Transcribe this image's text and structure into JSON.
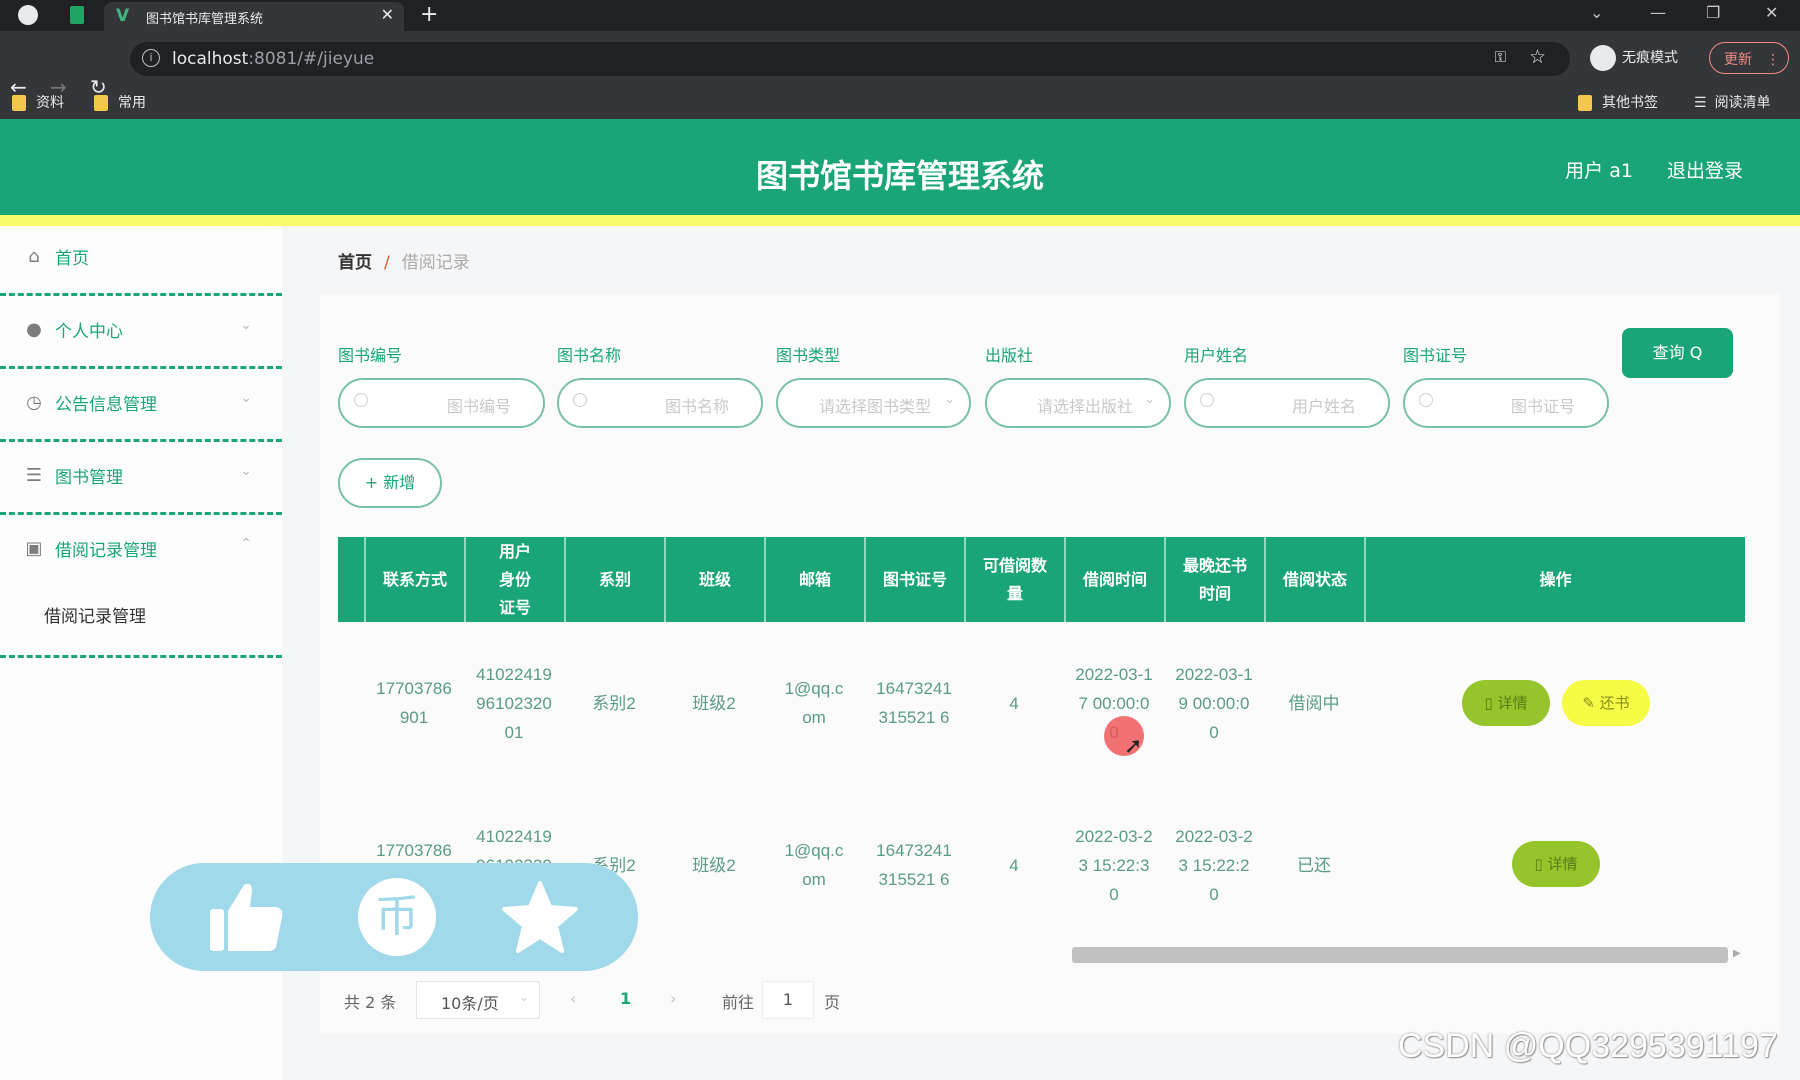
{
  "browser": {
    "tab_title": "图书馆书库管理系统",
    "url_host": "localhost",
    "url_path": ":8081/#/jieyue",
    "incognito_label": "无痕模式",
    "update_label": "更新",
    "bookmarks_left": [
      "资料",
      "常用"
    ],
    "bookmarks_right": [
      "其他书签",
      "阅读清单"
    ]
  },
  "header": {
    "title": "图书馆书库管理系统",
    "user_label": "用户 a1",
    "logout_label": "退出登录"
  },
  "sidebar": {
    "items": [
      {
        "label": "首页",
        "icon": "home-icon"
      },
      {
        "label": "个人中心",
        "icon": "user-icon"
      },
      {
        "label": "公告信息管理",
        "icon": "clock-icon"
      },
      {
        "label": "图书管理",
        "icon": "list-icon"
      },
      {
        "label": "借阅记录管理",
        "icon": "clipboard-icon"
      }
    ],
    "sub_items": [
      "借阅记录管理"
    ]
  },
  "breadcrumb": {
    "home": "首页",
    "separator": "/",
    "current": "借阅记录"
  },
  "filters": [
    {
      "label": "图书编号",
      "placeholder": "图书编号",
      "type": "input"
    },
    {
      "label": "图书名称",
      "placeholder": "图书名称",
      "type": "input"
    },
    {
      "label": "图书类型",
      "placeholder": "请选择图书类型",
      "type": "select"
    },
    {
      "label": "出版社",
      "placeholder": "请选择出版社",
      "type": "select"
    },
    {
      "label": "用户姓名",
      "placeholder": "用户姓名",
      "type": "input"
    },
    {
      "label": "图书证号",
      "placeholder": "图书证号",
      "type": "input"
    }
  ],
  "buttons": {
    "query": "查询 Q",
    "add": "+ 新增",
    "detail": "详情",
    "return": "还书"
  },
  "table": {
    "columns": [
      "联系方式",
      "用户身份证号",
      "系别",
      "班级",
      "邮箱",
      "图书证号",
      "可借阅数量",
      "借阅时间",
      "最晚还书时间",
      "借阅状态",
      "操作"
    ],
    "rows": [
      {
        "phone": "17703786901",
        "id_card": "410224199610232001",
        "department": "系别2",
        "class": "班级2",
        "email": "1@qq.com",
        "card_no": "16473241315521 6",
        "quantity": "4",
        "borrow_time": "2022-03-17 00:00:00",
        "due_time": "2022-03-19 00:00:00",
        "status": "借阅中",
        "actions": [
          "详情",
          "还书"
        ]
      },
      {
        "phone": "17703786901",
        "id_card": "410224199610232001",
        "department": "系别2",
        "class": "班级2",
        "email": "1@qq.com",
        "card_no": "16473241315521 6",
        "quantity": "4",
        "borrow_time": "2022-03-23 15:22:30",
        "due_time": "2022-03-23 15:22:20",
        "status": "已还",
        "actions": [
          "详情"
        ]
      }
    ]
  },
  "pagination": {
    "total": "共 2 条",
    "page_size": "10条/页",
    "current_page": "1",
    "goto_label": "前往",
    "goto_value": "1",
    "page_suffix": "页"
  },
  "overlay": {
    "icons": [
      "thumbs-up-icon",
      "coin-icon",
      "star-icon"
    ]
  },
  "watermark": "CSDN @QQ3295391197",
  "colors": {
    "primary": "#1aa579",
    "accent_yellow": "#f6fb6b",
    "detail_btn": "#95c42b",
    "return_btn": "#f6fb46"
  }
}
